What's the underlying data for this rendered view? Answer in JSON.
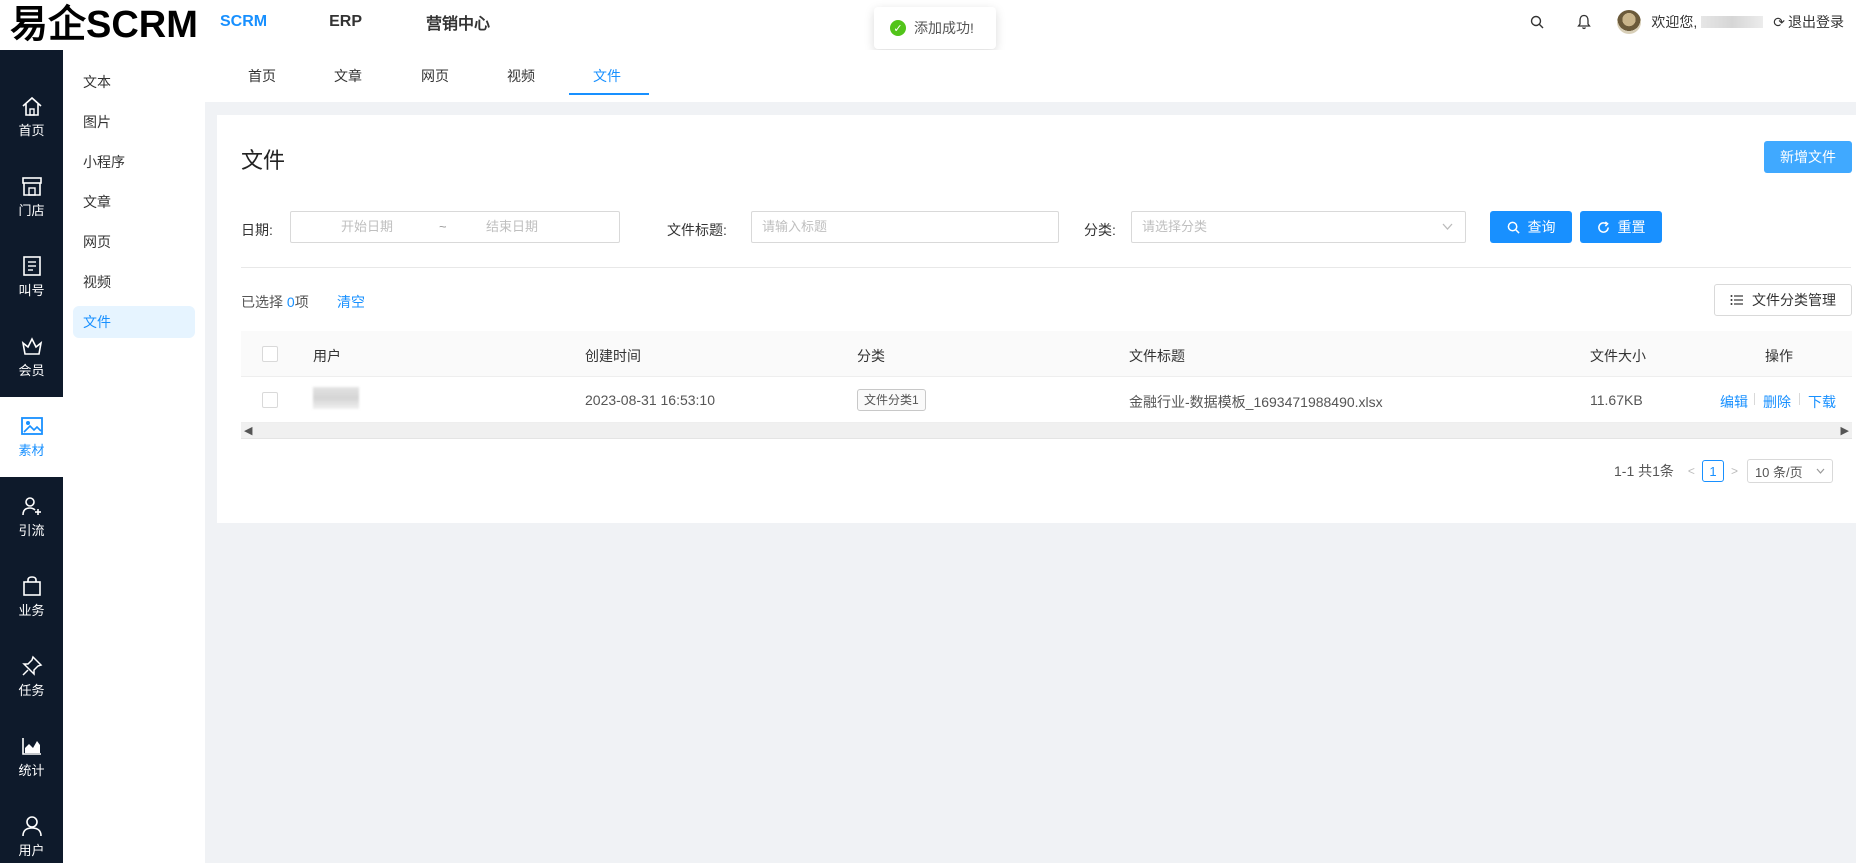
{
  "app": {
    "logo": "易企SCRM"
  },
  "topnav": {
    "items": [
      "SCRM",
      "ERP",
      "营销中心"
    ]
  },
  "toast": {
    "message": "添加成功!"
  },
  "user": {
    "welcome": "欢迎您,",
    "logout": "退出登录"
  },
  "sidebar": {
    "items": [
      "首页",
      "门店",
      "叫号",
      "会员",
      "素材",
      "引流",
      "业务",
      "任务",
      "统计",
      "用户"
    ]
  },
  "submenu": {
    "items": [
      "文本",
      "图片",
      "小程序",
      "文章",
      "网页",
      "视频",
      "文件"
    ]
  },
  "tabs": [
    "首页",
    "文章",
    "网页",
    "视频",
    "文件"
  ],
  "page": {
    "title": "文件",
    "new_button": "新增文件"
  },
  "filters": {
    "date_label": "日期:",
    "start_placeholder": "开始日期",
    "range_sep": "~",
    "end_placeholder": "结束日期",
    "title_label": "文件标题:",
    "title_placeholder": "请输入标题",
    "category_label": "分类:",
    "category_placeholder": "请选择分类",
    "query_button": "查询",
    "reset_button": "重置"
  },
  "selection": {
    "prefix": "已选择 ",
    "count": "0",
    "suffix": "项",
    "clear": "清空",
    "category_manage": "文件分类管理"
  },
  "table": {
    "columns": [
      "用户",
      "创建时间",
      "分类",
      "文件标题",
      "文件大小",
      "操作"
    ],
    "rows": [
      {
        "created": "2023-08-31 16:53:10",
        "category": "文件分类1",
        "title": "金融行业-数据模板_1693471988490.xlsx",
        "size": "11.67KB",
        "actions": [
          "编辑",
          "删除",
          "下载"
        ]
      }
    ]
  },
  "pagination": {
    "summary": "1-1 共1条",
    "current": "1",
    "page_size": "10 条/页"
  },
  "colors": {
    "accent": "#1890ff",
    "sidebar_bg": "#0e1a2b",
    "success": "#52c41a"
  }
}
